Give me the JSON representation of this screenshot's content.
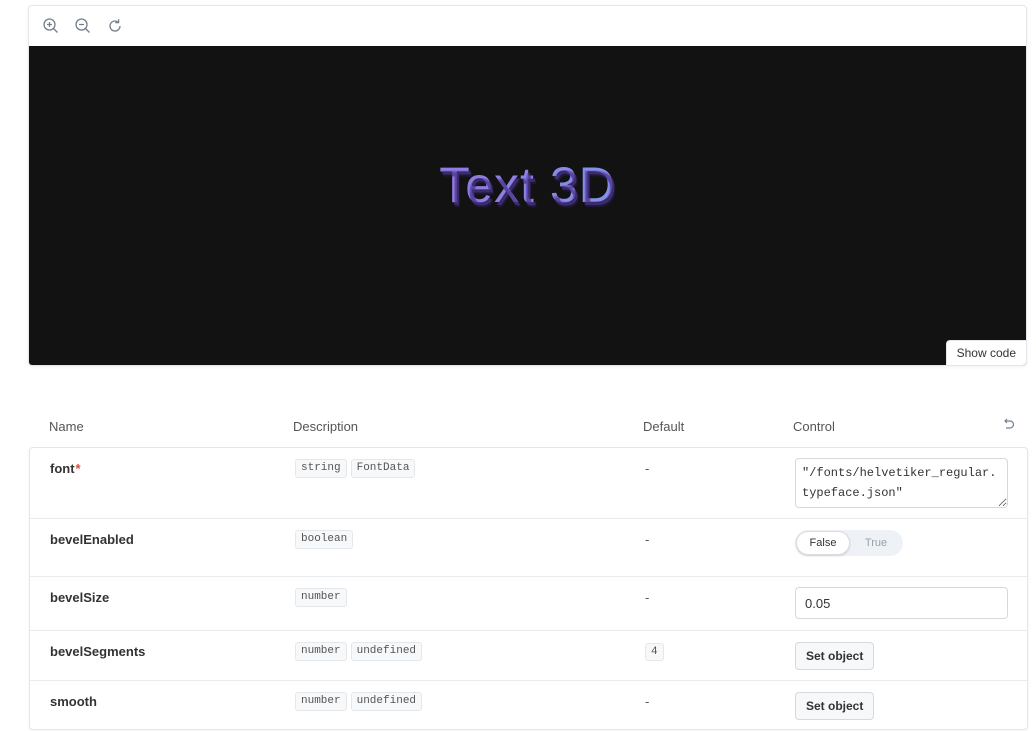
{
  "preview": {
    "toolbar": {
      "zoom_in": "zoom-in-icon",
      "zoom_out": "zoom-out-icon",
      "reset": "reset-zoom-icon"
    },
    "canvas_text": "Text 3D",
    "canvas_bg": "#121212",
    "show_code_label": "Show code"
  },
  "table": {
    "headers": {
      "name": "Name",
      "description": "Description",
      "default": "Default",
      "control": "Control"
    },
    "rows": [
      {
        "name": "font",
        "required": "*",
        "types": [
          "string",
          "FontData"
        ],
        "default": "-",
        "control": "\"/fonts/helvetiker_regular.typeface.json\""
      },
      {
        "name": "bevelEnabled",
        "types": [
          "boolean"
        ],
        "default": "-",
        "control": {
          "false_label": "False",
          "true_label": "True",
          "selected": "False"
        }
      },
      {
        "name": "bevelSize",
        "types": [
          "number"
        ],
        "default": "-",
        "control": "0.05"
      },
      {
        "name": "bevelSegments",
        "types": [
          "number",
          "undefined"
        ],
        "default": "4",
        "control": "Set object"
      },
      {
        "name": "smooth",
        "types": [
          "number",
          "undefined"
        ],
        "default": "-",
        "control": "Set object"
      }
    ]
  },
  "colors": {
    "required": "#e0473b",
    "canvas": "#121212"
  }
}
